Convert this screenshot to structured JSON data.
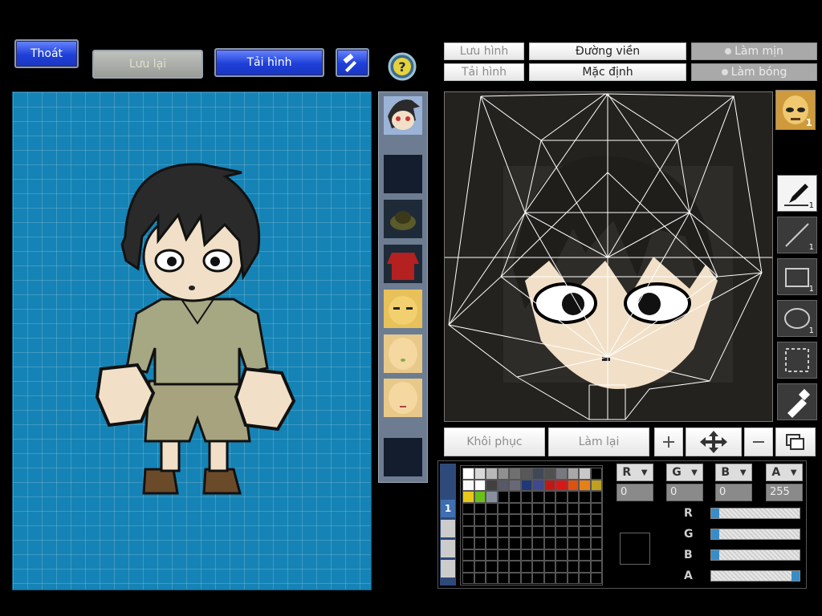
{
  "top_left_buttons": {
    "exit": "Thoát",
    "save": "Lưu lại",
    "reload": "Tải hình"
  },
  "editor_top": {
    "save_image": "Lưu hình",
    "load_image": "Tải hình",
    "outline": "Đường viền",
    "default": "Mặc định",
    "smooth": "Làm mịn",
    "shade": "Làm bóng"
  },
  "avatar_badge": "1",
  "tools": [
    {
      "name": "pen",
      "count": "1"
    },
    {
      "name": "line",
      "count": "1"
    },
    {
      "name": "rectangle",
      "count": "1"
    },
    {
      "name": "ellipse",
      "count": "1"
    },
    {
      "name": "selection",
      "count": ""
    },
    {
      "name": "eyedropper",
      "count": ""
    }
  ],
  "bottom_actions": {
    "restore": "Khôi phục",
    "redo": "Làm lại"
  },
  "palette": {
    "page_tab": "1",
    "colors_row1": [
      "#ffffff",
      "#d8d8d8",
      "#b8b8b8",
      "#909090",
      "#707070",
      "#585858",
      "#404858",
      "#505050",
      "#787880",
      "#a8a8a8",
      "#c8c8c8"
    ],
    "colors_row2": [
      "#f8f8f8",
      "#ffffff",
      "#404040",
      "#585868",
      "#686878",
      "#203878",
      "#404890",
      "#c01818",
      "#d81818",
      "#e05010",
      "#e88018",
      "#c0a020"
    ],
    "colors_row3": [
      "#e8c818",
      "#68c018",
      "#8890a0"
    ]
  },
  "channels": [
    {
      "label": "R",
      "value": "0"
    },
    {
      "label": "G",
      "value": "0"
    },
    {
      "label": "B",
      "value": "0"
    },
    {
      "label": "A",
      "value": "255"
    }
  ],
  "sliders": [
    {
      "label": "R",
      "fraction": 0.0
    },
    {
      "label": "G",
      "fraction": 0.0
    },
    {
      "label": "B",
      "fraction": 0.0
    },
    {
      "label": "A",
      "fraction": 1.0
    }
  ]
}
